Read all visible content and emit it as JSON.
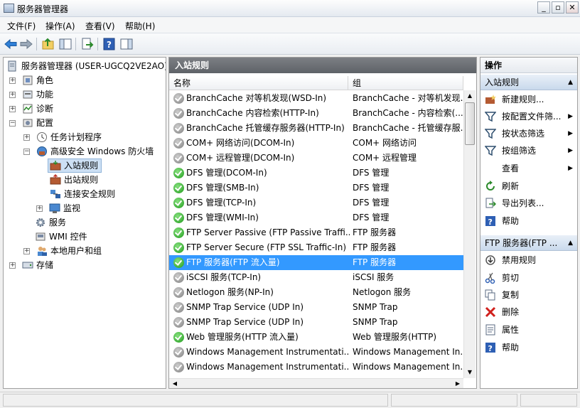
{
  "window": {
    "title": "服务器管理器",
    "minimize": "_",
    "restore": "▫",
    "close": "✕"
  },
  "menu": [
    "文件(F)",
    "操作(A)",
    "查看(V)",
    "帮助(H)"
  ],
  "tree": {
    "root": "服务器管理器 (USER-UGCQ2VE2AO)",
    "roles": "角色",
    "features": "功能",
    "diagnostics": "诊断",
    "config": "配置",
    "task_scheduler": "任务计划程序",
    "firewall": "高级安全 Windows 防火墙",
    "inbound": "入站规则",
    "outbound": "出站规则",
    "conn_security": "连接安全规则",
    "monitor": "监视",
    "services": "服务",
    "wmi": "WMI 控件",
    "local_users": "本地用户和组",
    "storage": "存储"
  },
  "middle": {
    "title": "入站规则",
    "col_name": "名称",
    "col_group": "组",
    "rows": [
      {
        "name": "BranchCache 对等机发现(WSD-In)",
        "group": "BranchCache - 对等机发现...",
        "enabled": false
      },
      {
        "name": "BranchCache 内容检索(HTTP-In)",
        "group": "BranchCache - 内容检索(...",
        "enabled": false
      },
      {
        "name": "BranchCache 托管缓存服务器(HTTP-In)",
        "group": "BranchCache - 托管缓存服...",
        "enabled": false
      },
      {
        "name": "COM+ 网络访问(DCOM-In)",
        "group": "COM+ 网络访问",
        "enabled": false
      },
      {
        "name": "COM+ 远程管理(DCOM-In)",
        "group": "COM+ 远程管理",
        "enabled": false
      },
      {
        "name": "DFS 管理(DCOM-In)",
        "group": "DFS 管理",
        "enabled": true
      },
      {
        "name": "DFS 管理(SMB-In)",
        "group": "DFS 管理",
        "enabled": true
      },
      {
        "name": "DFS 管理(TCP-In)",
        "group": "DFS 管理",
        "enabled": true
      },
      {
        "name": "DFS 管理(WMI-In)",
        "group": "DFS 管理",
        "enabled": true
      },
      {
        "name": "FTP Server Passive (FTP Passive Traffi...",
        "group": "FTP 服务器",
        "enabled": true
      },
      {
        "name": "FTP Server Secure (FTP SSL Traffic-In)",
        "group": "FTP 服务器",
        "enabled": true
      },
      {
        "name": "FTP 服务器(FTP 流入量)",
        "group": "FTP 服务器",
        "enabled": true
      },
      {
        "name": "iSCSI 服务(TCP-In)",
        "group": "iSCSI 服务",
        "enabled": false
      },
      {
        "name": "Netlogon 服务(NP-In)",
        "group": "Netlogon 服务",
        "enabled": false
      },
      {
        "name": "SNMP Trap Service (UDP In)",
        "group": "SNMP Trap",
        "enabled": false
      },
      {
        "name": "SNMP Trap Service (UDP In)",
        "group": "SNMP Trap",
        "enabled": false
      },
      {
        "name": "Web 管理服务(HTTP 流入量)",
        "group": "Web 管理服务(HTTP)",
        "enabled": true
      },
      {
        "name": "Windows Management Instrumentati...",
        "group": "Windows Management In...",
        "enabled": false
      },
      {
        "name": "Windows Management Instrumentati...",
        "group": "Windows Management In...",
        "enabled": false
      }
    ]
  },
  "actions": {
    "title": "操作",
    "section1": "入站规则",
    "new_rule": "新建规则...",
    "filter_profile": "按配置文件筛...",
    "filter_state": "按状态筛选",
    "filter_group": "按组筛选",
    "view": "查看",
    "refresh": "刷新",
    "export": "导出列表...",
    "help": "帮助",
    "section2": "FTP 服务器(FTP ...",
    "disable": "禁用规则",
    "cut": "剪切",
    "copy": "复制",
    "delete": "删除",
    "properties": "属性",
    "help2": "帮助"
  }
}
